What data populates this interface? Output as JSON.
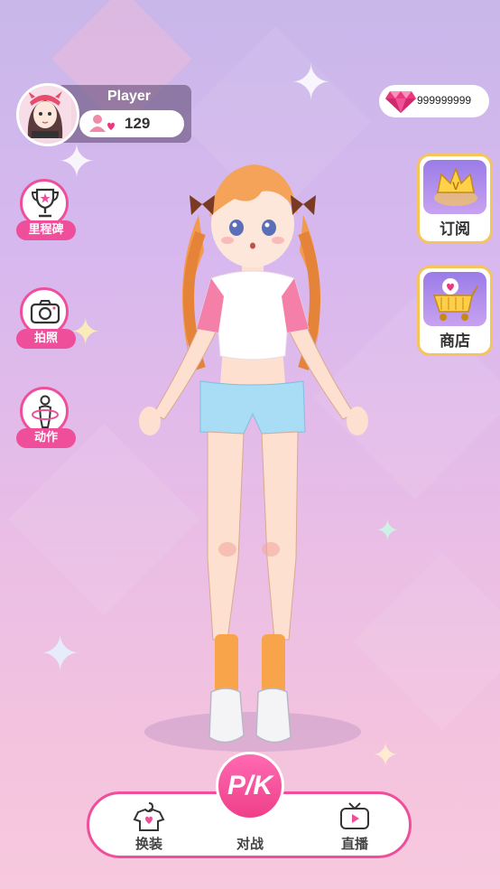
{
  "player": {
    "name": "Player",
    "followers": "129"
  },
  "currency": {
    "gems": "999999999"
  },
  "left_menu": [
    {
      "label": "里程碑",
      "icon": "trophy-icon"
    },
    {
      "label": "拍照",
      "icon": "camera-icon"
    },
    {
      "label": "动作",
      "icon": "pose-icon"
    }
  ],
  "right_menu": [
    {
      "label": "订阅",
      "icon": "crown-icon"
    },
    {
      "label": "商店",
      "icon": "shopping-cart-icon"
    }
  ],
  "bottom_nav": {
    "dress_up": "换装",
    "battle": "对战",
    "battle_badge": "P/K",
    "live": "直播"
  },
  "colors": {
    "accent": "#ef4f9a",
    "gold": "#f5c45a",
    "gem": "#e8397f"
  }
}
